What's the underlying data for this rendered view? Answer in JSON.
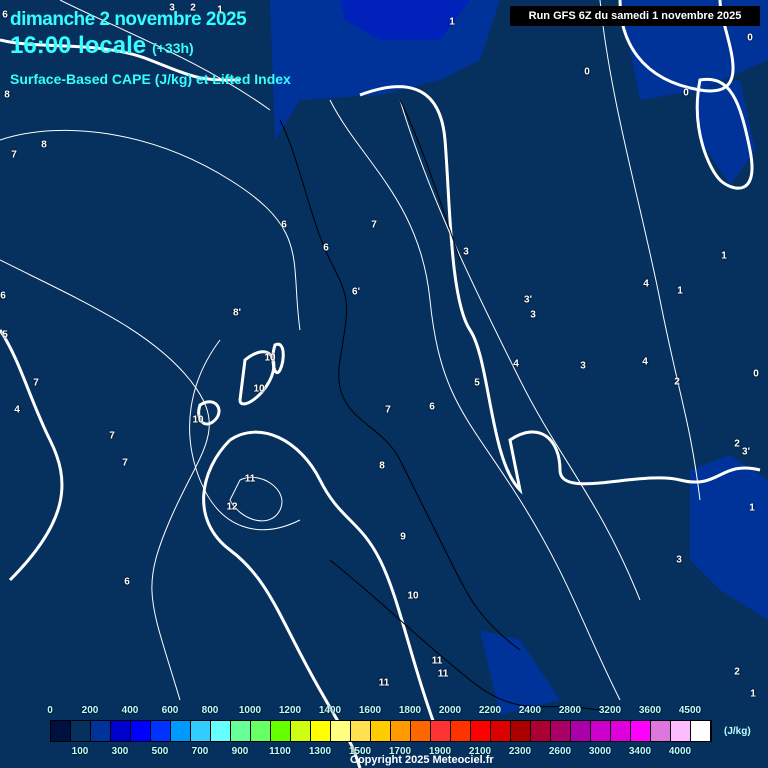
{
  "header": {
    "date": "dimanche 2 novembre 2025",
    "time": "16:00 locale",
    "offset": "(+33h)",
    "title": "Surface-Based CAPE (J/kg) et Lifted Index",
    "run": "Run GFS 6Z du samedi 1 novembre 2025"
  },
  "contour_labels": [
    "6",
    "3",
    "2",
    "1",
    "1",
    "0",
    "0",
    "0",
    "8",
    "8",
    "7",
    "6",
    "6",
    "6'",
    "7",
    "3",
    "3'",
    "3",
    "4",
    "1",
    "1",
    "8'",
    "10",
    "10",
    "10",
    "6",
    "5",
    "4",
    "4",
    "3",
    "2",
    "0",
    "7",
    "6",
    "7",
    "5",
    "4",
    "7",
    "7",
    "8",
    "11",
    "12",
    "9",
    "10",
    "11",
    "11",
    "11",
    "6",
    "2",
    "3'",
    "1",
    "3",
    "2",
    "1"
  ],
  "legend": {
    "top_labels": [
      "0",
      "200",
      "400",
      "600",
      "800",
      "1000",
      "1200",
      "1400",
      "1600",
      "1800",
      "2000",
      "2200",
      "2400",
      "2800",
      "3200",
      "3600",
      "4500"
    ],
    "bottom_labels": [
      "100",
      "300",
      "500",
      "700",
      "900",
      "1100",
      "1300",
      "1500",
      "1700",
      "1900",
      "2100",
      "2300",
      "2600",
      "3000",
      "3400",
      "4000"
    ],
    "unit": "(J/kg)",
    "colors": [
      "#001040",
      "#06305e",
      "#003399",
      "#0000cc",
      "#0000ff",
      "#0033ff",
      "#0099ff",
      "#33ccff",
      "#66ffff",
      "#66ff99",
      "#66ff66",
      "#66ff00",
      "#ccff11",
      "#ffff00",
      "#ffff80",
      "#ffe050",
      "#ffcc00",
      "#ff9900",
      "#ff6600",
      "#ff3333",
      "#ff3300",
      "#ff0000",
      "#dd0000",
      "#aa0000",
      "#aa0033",
      "#aa0066",
      "#aa00aa",
      "#cc00cc",
      "#dd00dd",
      "#ff00ff",
      "#dd77dd",
      "#ffbbff",
      "#ffffff"
    ]
  },
  "copyright": "Copyright 2025 Meteociel.fr"
}
